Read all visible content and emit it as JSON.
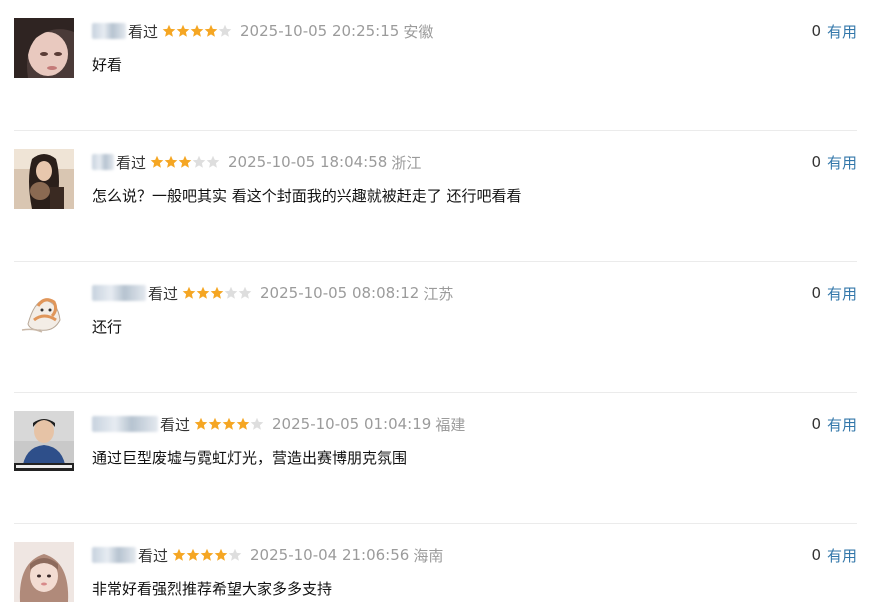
{
  "comments": [
    {
      "status": "看过",
      "rating": 4,
      "time": "2025-10-05 20:25:15",
      "region": "安徽",
      "content": "好看",
      "votes": "0",
      "useful_label": "有用"
    },
    {
      "status": "看过",
      "rating": 3,
      "time": "2025-10-05 18:04:58",
      "region": "浙江",
      "content": "怎么说？一般吧其实 看这个封面我的兴趣就被赶走了 还行吧看看",
      "votes": "0",
      "useful_label": "有用"
    },
    {
      "status": "看过",
      "rating": 3,
      "time": "2025-10-05 08:08:12",
      "region": "江苏",
      "content": "还行",
      "votes": "0",
      "useful_label": "有用"
    },
    {
      "status": "看过",
      "rating": 4,
      "time": "2025-10-05 01:04:19",
      "region": "福建",
      "content": "通过巨型废墟与霓虹灯光，营造出赛博朋克氛围",
      "votes": "0",
      "useful_label": "有用"
    },
    {
      "status": "看过",
      "rating": 4,
      "time": "2025-10-04 21:06:56",
      "region": "海南",
      "content": "非常好看强烈推荐希望大家多多支持",
      "votes": "0",
      "useful_label": "有用"
    }
  ],
  "colors": {
    "star_on": "#f5a623",
    "star_off": "#dedede",
    "useful": "#3377aa",
    "meta": "#9b9b9b"
  }
}
